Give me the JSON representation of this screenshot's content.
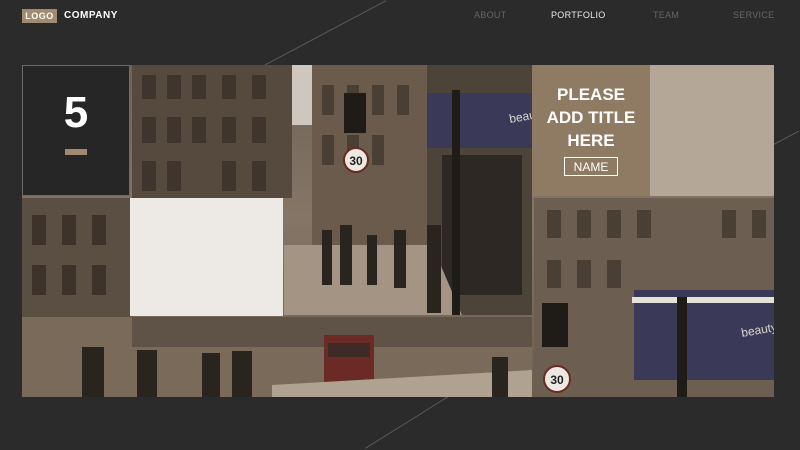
{
  "header": {
    "logo": "LOGO",
    "company": "COMPANY",
    "nav": [
      {
        "label": "ABOUT",
        "active": false
      },
      {
        "label": "PORTFOLIO",
        "active": true
      },
      {
        "label": "TEAM",
        "active": false
      },
      {
        "label": "SERVICE",
        "active": false
      }
    ]
  },
  "hero": {
    "number": "5",
    "title_line1": "PLEASE",
    "title_line2": "ADD TITLE",
    "title_line3": "HERE",
    "name_button": "NAME",
    "sign_text": "30",
    "shop_text": "beauty"
  },
  "colors": {
    "background": "#2b2b2b",
    "accent": "#a08a70",
    "title_block": "#8f7a63",
    "tan_block": "#b5a797",
    "light_block": "#ede9e4"
  }
}
